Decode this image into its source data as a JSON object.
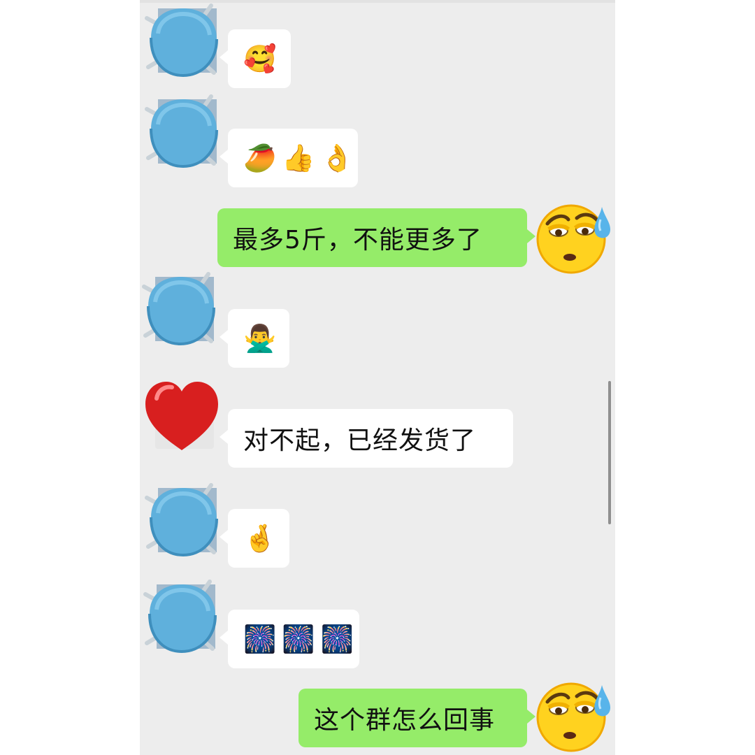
{
  "messages": [
    {
      "from": "other",
      "avatar": "mask-avatar",
      "emoji": [
        "🥰"
      ]
    },
    {
      "from": "other",
      "avatar": "mask-avatar",
      "emoji": [
        "🥭",
        "👍",
        "👌"
      ]
    },
    {
      "from": "self",
      "avatar": "sweat-face-avatar",
      "text": "最多5斤，不能更多了"
    },
    {
      "from": "other",
      "avatar": "mask-avatar",
      "emoji": [
        "🙅‍♂️"
      ]
    },
    {
      "from": "other",
      "avatar": "heart-avatar",
      "text": "对不起，已经发货了"
    },
    {
      "from": "other",
      "avatar": "mask-avatar",
      "emoji": [
        "🤞"
      ]
    },
    {
      "from": "other",
      "avatar": "mask-avatar",
      "emoji": [
        "🎆",
        "🎆",
        "🎆"
      ]
    },
    {
      "from": "self",
      "avatar": "sweat-face-avatar",
      "text": "这个群怎么回事"
    }
  ],
  "colors": {
    "background": "#ededed",
    "incoming_bubble": "#ffffff",
    "outgoing_bubble": "#95ec69",
    "text": "#111111"
  }
}
